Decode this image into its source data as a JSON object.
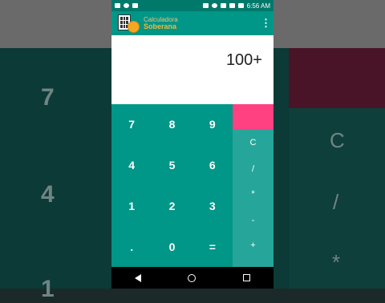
{
  "status_bar": {
    "time": "6:56 AM"
  },
  "app": {
    "name_line1": "Calculadora",
    "name_line2": "Soberana",
    "menu_icon": "more-vert-icon"
  },
  "display": {
    "expression": "100+"
  },
  "keypad": {
    "row1": [
      "7",
      "8",
      "9"
    ],
    "row2": [
      "4",
      "5",
      "6"
    ],
    "row3": [
      "1",
      "2",
      "3"
    ],
    "row4": [
      ".",
      "0",
      "="
    ]
  },
  "operators": {
    "clear": "C",
    "divide": "/",
    "multiply": "*",
    "minus": "-",
    "plus": "+"
  },
  "colors": {
    "primary": "#009688",
    "primary_dark": "#00796b",
    "operator_bg": "#26a69a",
    "accent": "#ff4081"
  },
  "background_blur": {
    "left_digits": [
      "7",
      "4",
      "1"
    ],
    "right_symbols": [
      "C",
      "/",
      "*"
    ]
  }
}
